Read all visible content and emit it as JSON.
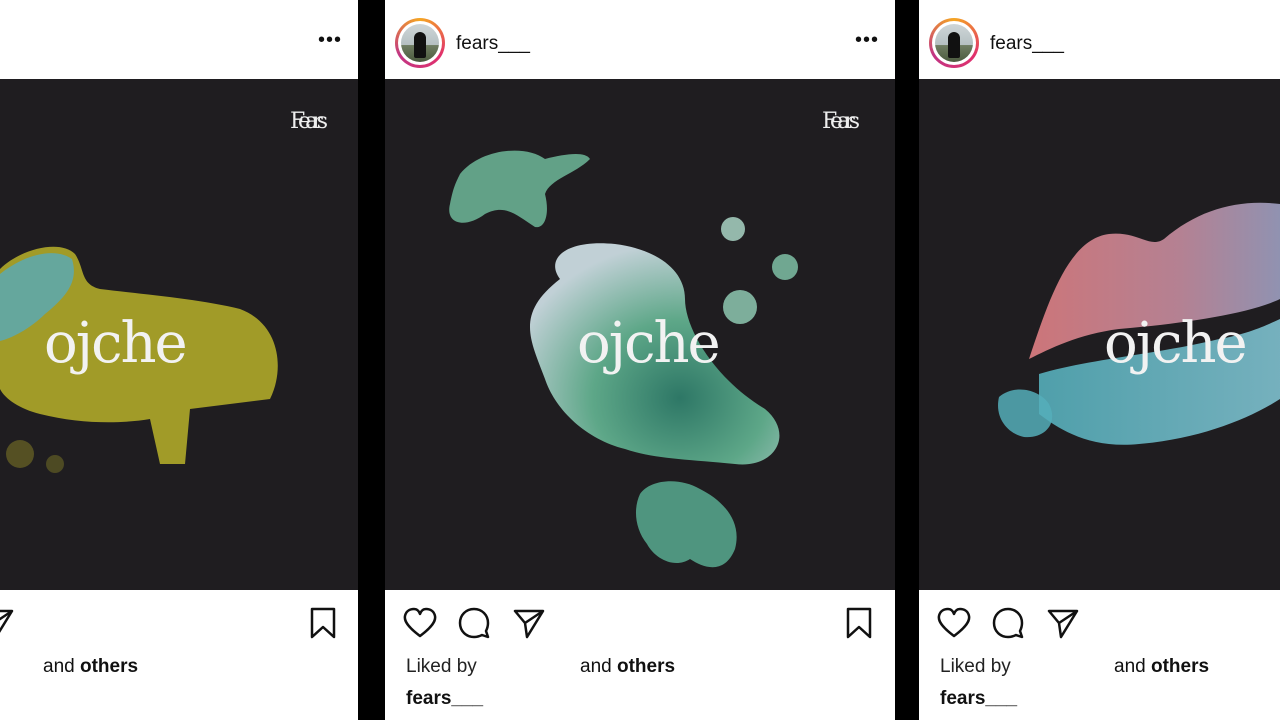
{
  "posts": [
    {
      "username": "",
      "liked_by": "",
      "and_label": "and",
      "others_label": "others",
      "caption_user": "",
      "wordmark": "ojche",
      "brand": "Fears",
      "palette": [
        "#5fa9a9",
        "#c8c032"
      ]
    },
    {
      "username": "fears___",
      "liked_by": "Liked by",
      "and_label": "and",
      "others_label": "others",
      "caption_user": "fears___",
      "wordmark": "ojche",
      "brand": "Fears",
      "palette": [
        "#cfe0e8",
        "#6fb89a",
        "#2f7a66"
      ]
    },
    {
      "username": "fears___",
      "liked_by": "Liked by",
      "and_label": "and",
      "others_label": "others",
      "caption_user": "fears___",
      "wordmark": "ojche",
      "brand": "",
      "palette": [
        "#e07f83",
        "#b59ab6",
        "#63b3c5"
      ]
    }
  ],
  "icons": [
    "more-icon",
    "heart-icon",
    "comment-icon",
    "share-icon",
    "bookmark-icon"
  ]
}
